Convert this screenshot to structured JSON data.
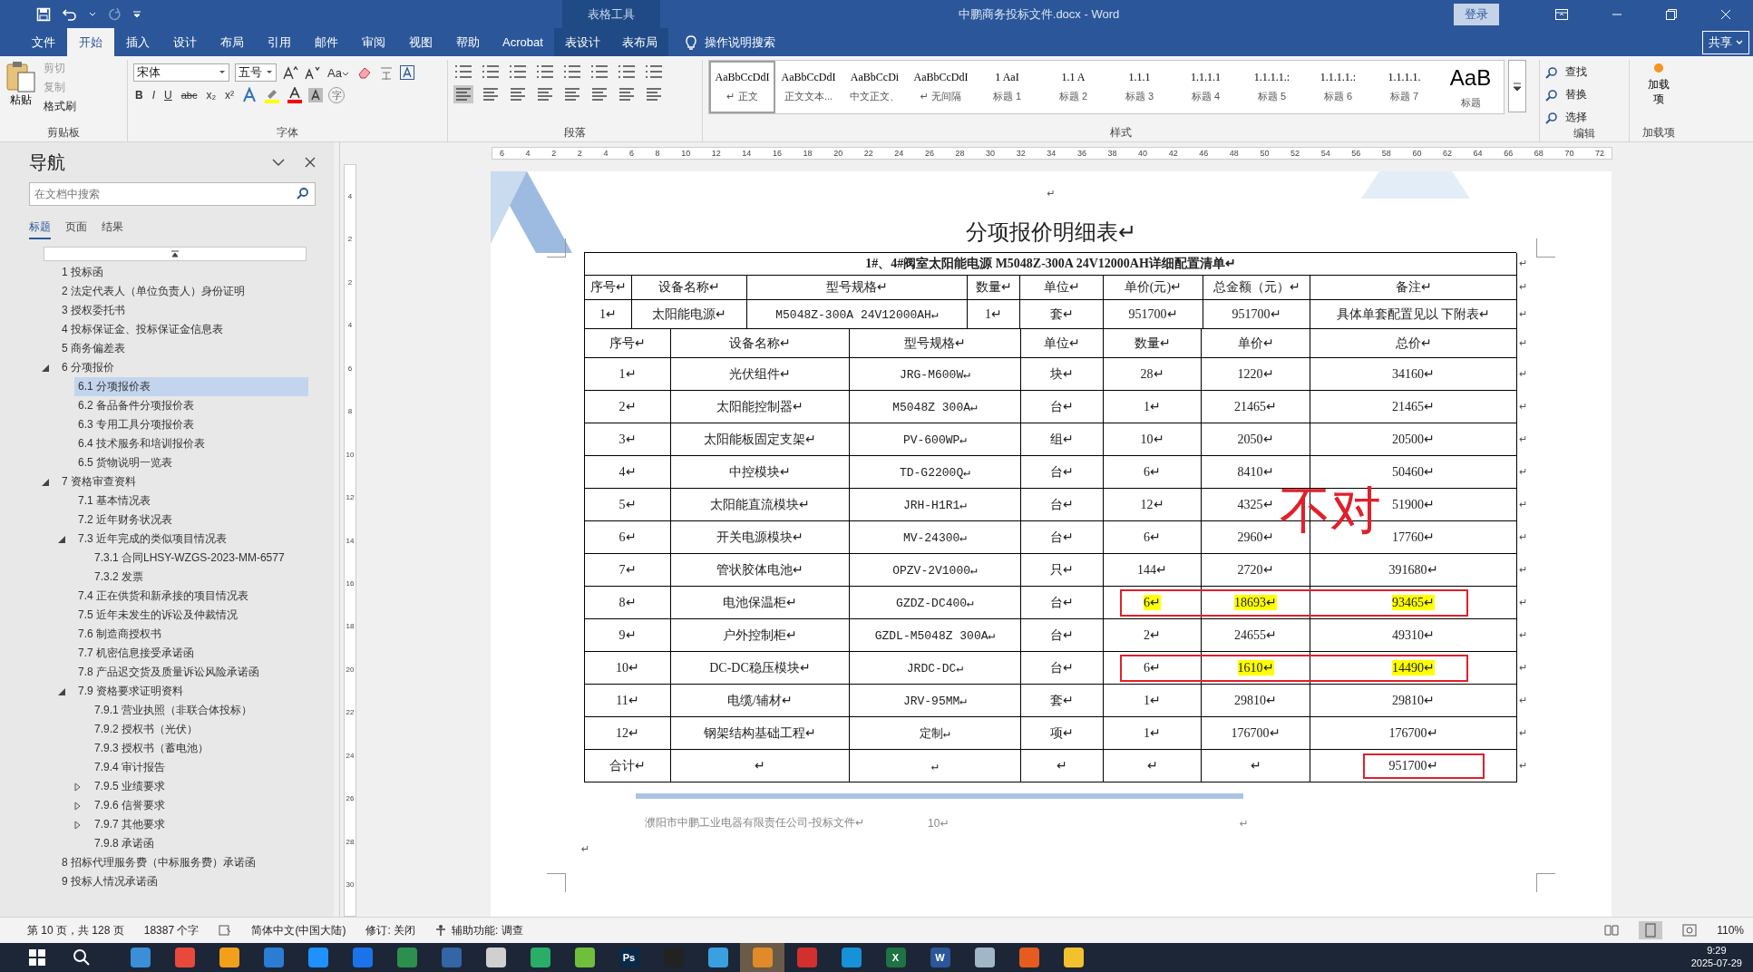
{
  "title_bar": {
    "context_label": "表格工具",
    "title": "中鹏商务投标文件.docx  -  Word",
    "login": "登录"
  },
  "tabs": [
    {
      "label": "文件",
      "selected": false,
      "contextual": false
    },
    {
      "label": "开始",
      "selected": true,
      "contextual": false
    },
    {
      "label": "插入",
      "selected": false,
      "contextual": false
    },
    {
      "label": "设计",
      "selected": false,
      "contextual": false
    },
    {
      "label": "布局",
      "selected": false,
      "contextual": false
    },
    {
      "label": "引用",
      "selected": false,
      "contextual": false
    },
    {
      "label": "邮件",
      "selected": false,
      "contextual": false
    },
    {
      "label": "审阅",
      "selected": false,
      "contextual": false
    },
    {
      "label": "视图",
      "selected": false,
      "contextual": false
    },
    {
      "label": "帮助",
      "selected": false,
      "contextual": false
    },
    {
      "label": "Acrobat",
      "selected": false,
      "contextual": false
    },
    {
      "label": "表设计",
      "selected": false,
      "contextual": true
    },
    {
      "label": "表布局",
      "selected": false,
      "contextual": true
    }
  ],
  "tell_me": "操作说明搜索",
  "share": "共享",
  "ribbon": {
    "clipboard": {
      "label": "剪贴板",
      "paste": "粘贴",
      "items": [
        {
          "label": "剪切",
          "disabled": true
        },
        {
          "label": "复制",
          "disabled": true
        },
        {
          "label": "格式刷",
          "disabled": false
        }
      ]
    },
    "font": {
      "label": "字体",
      "name": "宋体",
      "size": "五号",
      "case": "Aa",
      "format_buttons": [
        "B",
        "I",
        "U",
        "abc",
        "x₂",
        "x²"
      ],
      "enclose": "字"
    },
    "paragraph": {
      "label": "段落"
    },
    "styles": {
      "label": "样式",
      "items": [
        {
          "preview": "AaBbCcDdI",
          "name": "↵ 正文",
          "selected": true
        },
        {
          "preview": "AaBbCcDdI",
          "name": "正文文本...",
          "selected": false
        },
        {
          "preview": "AaBbCcDi",
          "name": "中文正文、",
          "selected": false
        },
        {
          "preview": "AaBbCcDdI",
          "name": "↵ 无间隔",
          "selected": false
        },
        {
          "preview": "1 AaI",
          "name": "标题 1",
          "selected": false
        },
        {
          "preview": "1.1 A",
          "name": "标题 2",
          "selected": false
        },
        {
          "preview": "1.1.1",
          "name": "标题 3",
          "selected": false
        },
        {
          "preview": "1.1.1.1",
          "name": "标题 4",
          "selected": false
        },
        {
          "preview": "1.1.1.1.:",
          "name": "标题 5",
          "selected": false
        },
        {
          "preview": "1.1.1.1.:",
          "name": "标题 6",
          "selected": false
        },
        {
          "preview": "1.1.1.1.",
          "name": "标题 7",
          "selected": false
        },
        {
          "preview": "AaB",
          "name": "标题",
          "selected": false
        }
      ]
    },
    "editing": {
      "label": "编辑",
      "items": [
        "查找",
        "替换",
        "选择"
      ]
    },
    "addins": {
      "label": "加载项",
      "button": "加载项"
    }
  },
  "nav": {
    "title": "导航",
    "search_placeholder": "在文档中搜索",
    "tabs": [
      {
        "label": "标题",
        "selected": true
      },
      {
        "label": "页面",
        "selected": false
      },
      {
        "label": "结果",
        "selected": false
      }
    ],
    "items": [
      {
        "label": "1 投标函",
        "selected": false
      },
      {
        "label": "2 法定代表人（单位负责人）身份证明",
        "selected": false
      },
      {
        "label": "3 授权委托书",
        "selected": false
      },
      {
        "label": "4 投标保证金、投标保证金信息表",
        "selected": false
      },
      {
        "label": "5 商务偏差表",
        "selected": false
      },
      {
        "label": "6 分项报价",
        "selected": false,
        "expanded": true,
        "children": [
          {
            "label": "6.1 分项报价表",
            "selected": true
          },
          {
            "label": "6.2 备品备件分项报价表",
            "selected": false
          },
          {
            "label": "6.3 专用工具分项报价表",
            "selected": false
          },
          {
            "label": "6.4 技术服务和培训报价表",
            "selected": false
          },
          {
            "label": "6.5 货物说明一览表",
            "selected": false
          }
        ]
      },
      {
        "label": "7 资格审查资料",
        "selected": false,
        "expanded": true,
        "children": [
          {
            "label": "7.1 基本情况表",
            "selected": false
          },
          {
            "label": "7.2 近年财务状况表",
            "selected": false
          },
          {
            "label": "7.3 近年完成的类似项目情况表",
            "selected": false,
            "expanded": true,
            "children": [
              {
                "label": "7.3.1 合同LHSY-WZGS-2023-MM-6577",
                "selected": false
              },
              {
                "label": "7.3.2 发票",
                "selected": false
              }
            ]
          },
          {
            "label": "7.4 正在供货和新承接的项目情况表",
            "selected": false
          },
          {
            "label": "7.5 近年未发生的诉讼及仲裁情况",
            "selected": false
          },
          {
            "label": "7.6 制造商授权书",
            "selected": false
          },
          {
            "label": "7.7 机密信息接受承诺函",
            "selected": false
          },
          {
            "label": "7.8 产品迟交货及质量诉讼风险承诺函",
            "selected": false
          },
          {
            "label": "7.9 资格要求证明资料",
            "selected": false,
            "expanded": true,
            "children": [
              {
                "label": "7.9.1 营业执照（非联合体投标）",
                "selected": false
              },
              {
                "label": "7.9.2 授权书（光伏）",
                "selected": false
              },
              {
                "label": "7.9.3 授权书（蓄电池）",
                "selected": false
              },
              {
                "label": "7.9.4 审计报告",
                "selected": false
              },
              {
                "label": "7.9.5 业绩要求",
                "selected": false,
                "expanded": false
              },
              {
                "label": "7.9.6 信誉要求",
                "selected": false,
                "expanded": false
              },
              {
                "label": "7.9.7 其他要求",
                "selected": false,
                "expanded": false
              },
              {
                "label": "7.9.8 承诺函",
                "selected": false
              }
            ]
          }
        ]
      },
      {
        "label": "8 招标代理服务费（中标服务费）承诺函",
        "selected": false
      },
      {
        "label": "9 投标人情况承诺函",
        "selected": false
      }
    ]
  },
  "ruler": {
    "h": [
      "6",
      "4",
      "2",
      "2",
      "4",
      "6",
      "8",
      "10",
      "12",
      "14",
      "16",
      "18",
      "20",
      "22",
      "24",
      "26",
      "28",
      "30",
      "32",
      "34",
      "36",
      "38",
      "40",
      "42",
      "46",
      "48",
      "50",
      "52",
      "54",
      "56",
      "58",
      "60",
      "62",
      "64",
      "66",
      "68",
      "70",
      "72"
    ],
    "v": [
      "4",
      "2",
      "2",
      "4",
      "6",
      "8",
      "10",
      "12",
      "14",
      "16",
      "18",
      "20",
      "22",
      "24",
      "26",
      "28",
      "30"
    ]
  },
  "document": {
    "top_mark": "↵",
    "heading": "分项报价明细表↵",
    "summary": {
      "title": "1#、4#阀室太阳能电源 M5048Z-300A 24V12000AH详细配置清单↵",
      "title_end": "↵",
      "header": {
        "cells": [
          "序号↵",
          "设备名称↵",
          "型号规格↵",
          "数量↵",
          "单位↵",
          "单价(元)↵",
          "总金额（元）↵",
          "备注↵"
        ],
        "end": "↵"
      },
      "row": {
        "cells": [
          "1↵",
          "太阳能电源↵",
          "M5048Z-300A 24V12000AH↵",
          "1↵",
          "套↵",
          "951700↵",
          "951700↵",
          "具体单套配置见以 下附表↵"
        ],
        "end": "↵"
      }
    },
    "detail": {
      "header": {
        "cells": [
          "序号↵",
          "设备名称↵",
          "型号规格↵",
          "单位↵",
          "数量↵",
          "单价↵",
          "总价↵"
        ],
        "end": "↵"
      },
      "rows": [
        {
          "cells": [
            "1↵",
            "光伏组件↵",
            "JRG-M600W↵",
            "块↵",
            "28↵",
            "1220↵",
            "34160↵"
          ],
          "end": "↵"
        },
        {
          "cells": [
            "2↵",
            "太阳能控制器↵",
            "M5048Z 300A↵",
            "台↵",
            "1↵",
            "21465↵",
            "21465↵"
          ],
          "end": "↵"
        },
        {
          "cells": [
            "3↵",
            "太阳能板固定支架↵",
            "PV-600WP↵",
            "组↵",
            "10↵",
            "2050↵",
            "20500↵"
          ],
          "end": "↵"
        },
        {
          "cells": [
            "4↵",
            "中控模块↵",
            "TD-G2200Q↵",
            "台↵",
            "6↵",
            "8410↵",
            "50460↵"
          ],
          "end": "↵"
        },
        {
          "cells": [
            "5↵",
            "太阳能直流模块↵",
            "JRH-H1R1↵",
            "台↵",
            "12↵",
            "4325↵",
            "51900↵"
          ],
          "end": "↵"
        },
        {
          "cells": [
            "6↵",
            "开关电源模块↵",
            "MV-24300↵",
            "台↵",
            "6↵",
            "2960↵",
            "17760↵"
          ],
          "end": "↵"
        },
        {
          "cells": [
            "7↵",
            "管状胶体电池↵",
            "OPZV-2V1000↵",
            "只↵",
            "144↵",
            "2720↵",
            "391680↵"
          ],
          "end": "↵"
        },
        {
          "cells": [
            "8↵",
            "电池保温柜↵",
            "GZDZ-DC400↵",
            "台↵",
            "6↵",
            "18693↵",
            "93465↵"
          ],
          "end": "↵",
          "highlights": [
            false,
            false,
            false,
            false,
            true,
            true,
            true
          ],
          "boxed": true
        },
        {
          "cells": [
            "9↵",
            "户外控制柜↵",
            "GZDL-M5048Z 300A↵",
            "台↵",
            "2↵",
            "24655↵",
            "49310↵"
          ],
          "end": "↵"
        },
        {
          "cells": [
            "10↵",
            "DC-DC稳压模块↵",
            "JRDC-DC↵",
            "台↵",
            "6↵",
            "1610↵",
            "14490↵"
          ],
          "end": "↵",
          "highlights": [
            false,
            false,
            false,
            false,
            false,
            true,
            true
          ],
          "boxed": true
        },
        {
          "cells": [
            "11↵",
            "电缆/辅材↵",
            "JRV-95MM↵",
            "套↵",
            "1↵",
            "29810↵",
            "29810↵"
          ],
          "end": "↵"
        },
        {
          "cells": [
            "12↵",
            "钢架结构基础工程↵",
            "定制↵",
            "项↵",
            "1↵",
            "176700↵",
            "176700↵"
          ],
          "end": "↵"
        },
        {
          "kind": "total",
          "cells": [
            "合计↵",
            "↵",
            "↵",
            "↵",
            "↵",
            "↵",
            "951700↵"
          ],
          "end": "↵",
          "boxed": true
        }
      ],
      "annotation": "不对"
    },
    "footer": {
      "company": "濮阳市中鹏工业电器有限责任公司-投标文件↵",
      "page": "10↵",
      "mark": "↵"
    },
    "bottom_mark": "↵"
  },
  "status_bar": {
    "page": "第 10 页，共 128 页",
    "words": "18387 个字",
    "language": "简体中文(中国大陆)",
    "track": "修订: 关闭",
    "accessibility": "辅助功能: 调查",
    "zoom": "110%"
  },
  "taskbar": {
    "apps": [
      {
        "color": "#3b8fd9",
        "selected": false
      },
      {
        "color": "#e8493b",
        "selected": false
      },
      {
        "color": "#f29f1c",
        "selected": false
      },
      {
        "color": "#2b7cd3",
        "selected": false
      },
      {
        "color": "#1e90ff",
        "selected": false
      },
      {
        "color": "#1a73e8",
        "selected": false
      },
      {
        "color": "#2d8f4e",
        "selected": false
      },
      {
        "color": "#3465a4",
        "selected": false
      },
      {
        "color": "#d0d0d0",
        "selected": false
      },
      {
        "color": "#2aae67",
        "selected": false
      },
      {
        "color": "#6fbf3b",
        "selected": false
      },
      {
        "color": "#0b2a4a",
        "label": "Ps",
        "selected": false
      },
      {
        "color": "#222222",
        "selected": false
      },
      {
        "color": "#3aa0e0",
        "selected": false
      },
      {
        "color": "#e08a2a",
        "selected": true
      },
      {
        "color": "#d32f2f",
        "selected": false
      },
      {
        "color": "#1592d8",
        "selected": false
      },
      {
        "color": "#1f7244",
        "label": "X",
        "selected": false
      },
      {
        "color": "#2b579a",
        "label": "W",
        "selected": false
      },
      {
        "color": "#9fb7c9",
        "selected": false
      },
      {
        "color": "#e55b20",
        "selected": false
      },
      {
        "color": "#f2c12e",
        "selected": false
      }
    ],
    "time": "9:29",
    "date": "2025-07-29"
  }
}
